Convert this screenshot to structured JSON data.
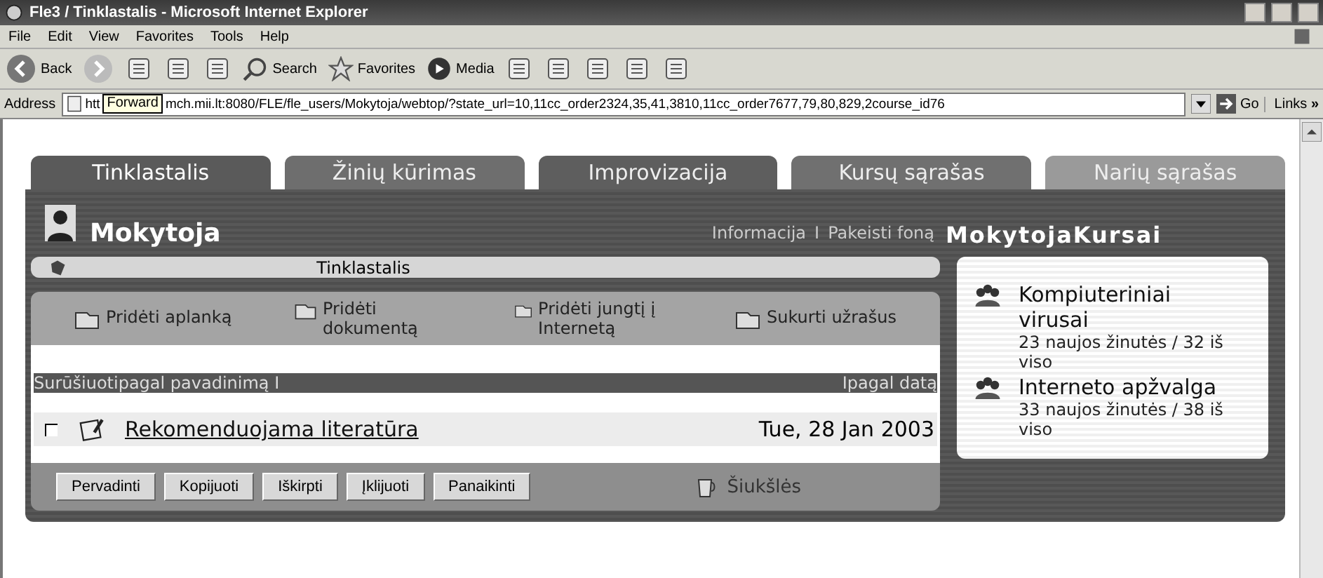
{
  "window": {
    "title": "Fle3 / Tinklastalis - Microsoft Internet Explorer"
  },
  "menu": [
    "File",
    "Edit",
    "View",
    "Favorites",
    "Tools",
    "Help"
  ],
  "toolbar": {
    "back": "Back",
    "search": "Search",
    "favorites": "Favorites",
    "media": "Media"
  },
  "address": {
    "label": "Address",
    "text_before": "htt",
    "text_after": "mch.mii.lt:8080/FLE/fle_users/Mokytoja/webtop/?state_url=10,11cc_order2324,35,41,3810,11cc_order7677,79,80,829,2course_id76",
    "go": "Go",
    "links": "Links",
    "more": "»"
  },
  "tooltip": "Forward",
  "tabs": [
    {
      "label": "Tinklastalis",
      "selected": true,
      "color": "#5a5a5a"
    },
    {
      "label": "Žinių kūrimas",
      "selected": false,
      "color": "#6e6e6e"
    },
    {
      "label": "Improvizacija",
      "selected": false,
      "color": "#5e5e5e"
    },
    {
      "label": "Kursų sąrašas",
      "selected": false,
      "color": "#707070"
    },
    {
      "label": "Narių sąrašas",
      "selected": false,
      "color": "#9a9a9a"
    }
  ],
  "user": {
    "name": "Mokytoja",
    "links": [
      "Informacija",
      "Pakeisti foną"
    ],
    "separator": "I"
  },
  "folder": {
    "title": "Tinklastalis"
  },
  "actions": [
    {
      "label": "Pridėti aplanką"
    },
    {
      "label": "Pridėti dokumentą"
    },
    {
      "label": "Pridėti jungtį į Internetą"
    },
    {
      "label": "Sukurti užrašus"
    }
  ],
  "sort": {
    "by_name": "Surūšiuotipagal pavadinimą",
    "separator": "I",
    "separator_2": "I",
    "by_date": "pagal datą"
  },
  "items": [
    {
      "title": "Rekomenduojama literatūra",
      "date": "Tue, 28 Jan 2003",
      "checked": false
    }
  ],
  "buttons": [
    "Pervadinti",
    "Kopijuoti",
    "Iškirpti",
    "Įklijuoti",
    "Panaikinti"
  ],
  "trash": "Šiukšlės",
  "courses": {
    "title": "MokytojaKursai",
    "items": [
      {
        "name": "Kompiuteriniai virusai",
        "stats": "23 naujos žinutės / 32 iš viso"
      },
      {
        "name": "Interneto apžvalga",
        "stats": "33 naujos žinutės / 38 iš viso"
      }
    ]
  }
}
